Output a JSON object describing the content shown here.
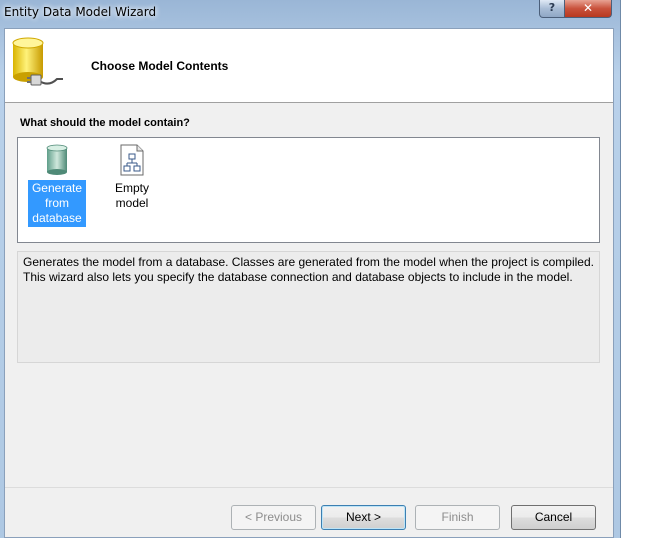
{
  "window": {
    "title": "Entity Data Model Wizard"
  },
  "title_buttons": {
    "help": "?",
    "close": "✕"
  },
  "header": {
    "title": "Choose Model Contents",
    "icon": "database-plug-icon"
  },
  "question": "What should the model contain?",
  "choices": [
    {
      "label": "Generate from database",
      "icon": "database-icon",
      "selected": true
    },
    {
      "label": "Empty model",
      "icon": "empty-model-icon",
      "selected": false
    }
  ],
  "description": "Generates the model from a database. Classes are generated from the model when the project is compiled. This wizard also lets you specify the database connection and database objects to include in the model.",
  "buttons": {
    "previous": "< Previous",
    "next": "Next >",
    "finish": "Finish",
    "cancel": "Cancel"
  },
  "colors": {
    "selection": "#3399ff",
    "frame": "#b9d1ea"
  }
}
